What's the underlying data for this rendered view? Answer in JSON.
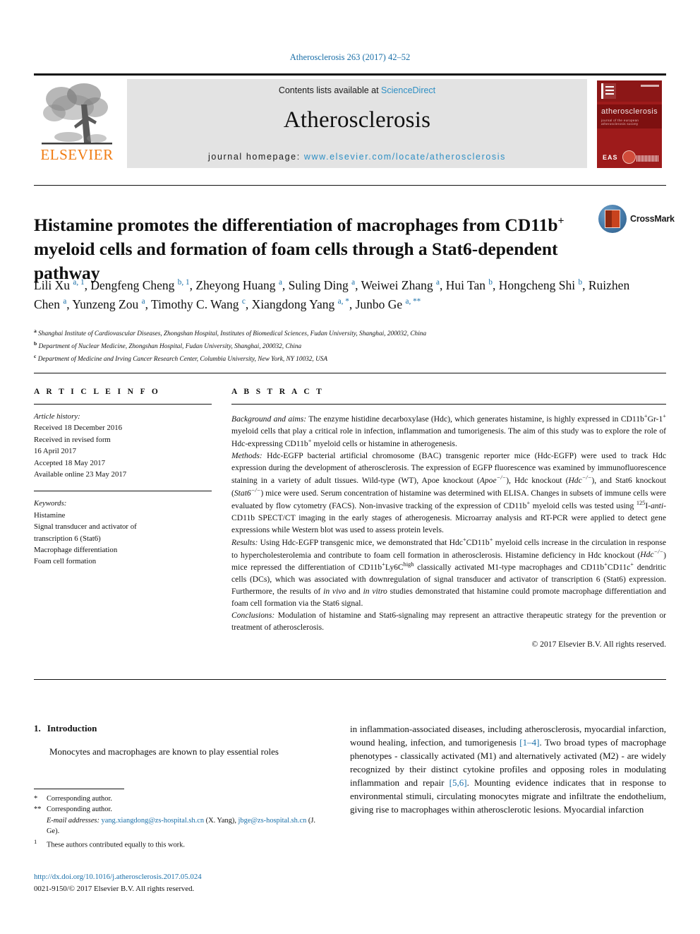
{
  "running_head": "Atherosclerosis 263 (2017) 42–52",
  "masthead": {
    "contents_prefix": "Contents lists available at ",
    "sciencedirect": "ScienceDirect",
    "journal_name": "Atherosclerosis",
    "homepage_prefix": "journal homepage: ",
    "homepage_url": "www.elsevier.com/locate/atherosclerosis",
    "publisher_wordmark": "ELSEVIER",
    "publisher_logo_icon": "elsevier-tree-icon",
    "cover": {
      "title": "atherosclerosis",
      "subtitle": "journal of the european atherosclerosis society",
      "society": "EAS",
      "icon": "journal-cover-thumbnail"
    },
    "colors": {
      "link_blue": "#2e8fc4",
      "elsevier_orange": "#f07c12",
      "band_grey": "#e3e3e3",
      "cover_red": "#9e1b1b"
    }
  },
  "crossmark": {
    "label": "CrossMark",
    "icon": "crossmark-badge-icon"
  },
  "article": {
    "title_part1": "Histamine promotes the differentiation of macrophages from CD11b",
    "title_sup1": "+",
    "title_part2": " myeloid cells and formation of foam cells through a Stat6-dependent pathway",
    "authors": [
      {
        "name": "Lili Xu",
        "marks": "a, 1",
        "sep": ", "
      },
      {
        "name": "Dengfeng Cheng",
        "marks": "b, 1",
        "sep": ", "
      },
      {
        "name": "Zheyong Huang",
        "marks": "a",
        "sep": ", "
      },
      {
        "name": "Suling Ding",
        "marks": "a",
        "sep": ", "
      },
      {
        "name": "Weiwei Zhang",
        "marks": "a",
        "sep": ", "
      },
      {
        "name": "Hui Tan",
        "marks": "b",
        "sep": ", "
      },
      {
        "name": "Hongcheng Shi",
        "marks": "b",
        "sep": ", "
      },
      {
        "name": "Ruizhen Chen",
        "marks": "a",
        "sep": ", "
      },
      {
        "name": "Yunzeng Zou",
        "marks": "a",
        "sep": ", "
      },
      {
        "name": "Timothy C. Wang",
        "marks": "c",
        "sep": ", "
      },
      {
        "name": "Xiangdong Yang",
        "marks": "a, *",
        "sep": ", "
      },
      {
        "name": "Junbo Ge",
        "marks": "a, **",
        "sep": ""
      }
    ],
    "affiliations": [
      {
        "mark": "a",
        "text": "Shanghai Institute of Cardiovascular Diseases, Zhongshan Hospital, Institutes of Biomedical Sciences, Fudan University, Shanghai, 200032, China"
      },
      {
        "mark": "b",
        "text": "Department of Nuclear Medicine, Zhongshan Hospital, Fudan University, Shanghai, 200032, China"
      },
      {
        "mark": "c",
        "text": "Department of Medicine and Irving Cancer Research Center, Columbia University, New York, NY 10032, USA"
      }
    ]
  },
  "article_info": {
    "heading": "A R T I C L E   I N F O",
    "history_label": "Article history:",
    "history": [
      "Received 18 December 2016",
      "Received in revised form",
      "16 April 2017",
      "Accepted 18 May 2017",
      "Available online 23 May 2017"
    ],
    "keywords_label": "Keywords:",
    "keywords": [
      "Histamine",
      "Signal transducer and activator of",
      "transcription 6 (Stat6)",
      "Macrophage differentiation",
      "Foam cell formation"
    ]
  },
  "abstract": {
    "heading": "A B S T R A C T",
    "sections": [
      {
        "label": "Background and aims:",
        "html": " The enzyme histidine decarboxylase (Hdc), which generates histamine, is highly expressed in CD11b<sup>+</sup>Gr-1<sup>+</sup> myeloid cells that play a critical role in infection, inflammation and tumorigenesis. The aim of this study was to explore the role of Hdc-expressing CD11b<sup>+</sup> myeloid cells or histamine in atherogenesis."
      },
      {
        "label": "Methods:",
        "html": " Hdc-EGFP bacterial artificial chromosome (BAC) transgenic reporter mice (Hdc-EGFP) were used to track Hdc expression during the development of atherosclerosis. The expression of EGFP fluorescence was examined by immunofluorescence staining in a variety of adult tissues. Wild-type (WT), Apoe knockout (<i>Apoe<sup>−/−</sup></i>), Hdc knockout (<i>Hdc<sup>−/−</sup></i>), and Stat6 knockout (<i>Stat6<sup>−/−</sup></i>) mice were used. Serum concentration of histamine was determined with ELISA. Changes in subsets of immune cells were evaluated by flow cytometry (FACS). Non-invasive tracking of the expression of CD11b<sup>+</sup> myeloid cells was tested using <sup>125</sup>I-<i>anti</i>-CD11b SPECT/CT imaging in the early stages of atherogenesis. Microarray analysis and RT-PCR were applied to detect gene expressions while Western blot was used to assess protein levels."
      },
      {
        "label": "Results:",
        "html": " Using Hdc-EGFP transgenic mice, we demonstrated that Hdc<sup>+</sup>CD11b<sup>+</sup> myeloid cells increase in the circulation in response to hypercholesterolemia and contribute to foam cell formation in atherosclerosis. Histamine deficiency in Hdc knockout (<i>Hdc<sup>−/−</sup></i>) mice repressed the differentiation of CD11b<sup>+</sup>Ly6C<sup>high</sup> classically activated M1-type macrophages and CD11b<sup>+</sup>CD11c<sup>+</sup> dendritic cells (DCs), which was associated with downregulation of signal transducer and activator of transcription 6 (Stat6) expression. Furthermore, the results of <i>in vivo</i> and <i>in vitro</i> studies demonstrated that histamine could promote macrophage differentiation and foam cell formation via the Stat6 signal."
      },
      {
        "label": "Conclusions:",
        "html": " Modulation of histamine and Stat6-signaling may represent an attractive therapeutic strategy for the prevention or treatment of atherosclerosis."
      }
    ],
    "copyright": "© 2017 Elsevier B.V. All rights reserved."
  },
  "body": {
    "section_number": "1.",
    "section_title": "Introduction",
    "left_paragraph": "Monocytes and macrophages are known to play essential roles",
    "right_paragraph_html": "in inflammation-associated diseases, including atherosclerosis, myocardial infarction, wound healing, infection, and tumorigenesis <span class=\"ref\">[1–4]</span>. Two broad types of macrophage phenotypes - classically activated (M1) and alternatively activated (M2) - are widely recognized by their distinct cytokine profiles and opposing roles in modulating inflammation and repair <span class=\"ref\">[5,6]</span>. Mounting evidence indicates that in response to environmental stimuli, circulating monocytes migrate and infiltrate the endothelium, giving rise to macrophages within atherosclerotic lesions. Myocardial infarction"
  },
  "footnotes": {
    "items": [
      {
        "mark": "*",
        "text": "Corresponding author."
      },
      {
        "mark": "**",
        "text": "Corresponding author."
      }
    ],
    "email_label": "E-mail addresses:",
    "email_html": " <span class=\"mailto\">yang.xiangdong@zs-hospital.sh.cn</span> (X. Yang), <span class=\"mailto\">jbge@zs-hospital.sh.cn</span> (J. Ge).",
    "equal_mark": "1",
    "equal_text": "These authors contributed equally to this work.",
    "doi": "http://dx.doi.org/10.1016/j.atherosclerosis.2017.05.024",
    "issn": "0021-9150/© 2017 Elsevier B.V. All rights reserved."
  }
}
